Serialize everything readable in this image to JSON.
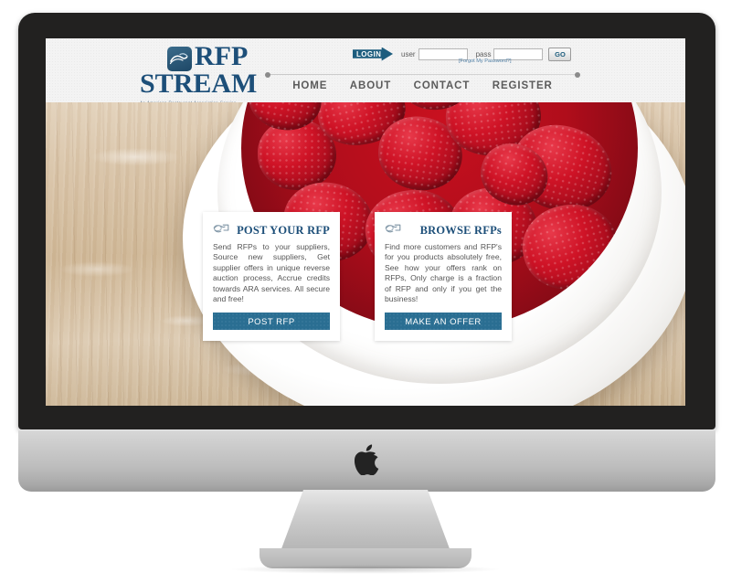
{
  "device": {
    "brand_logo": "apple-logo"
  },
  "site": {
    "logo": {
      "mark": "wave-logo-icon",
      "line1": "RFP",
      "line2": "STREAM",
      "tagline": "An American Restaurant Association Service"
    },
    "login": {
      "button_label": "LOGIN",
      "user_label": "user",
      "user_value": "",
      "user_placeholder": "",
      "pass_label": "pass",
      "pass_value": "",
      "pass_placeholder": "",
      "go_label": "GO",
      "forgot_label": "[Forgot My Password?]"
    },
    "nav": [
      {
        "label": "HOME"
      },
      {
        "label": "ABOUT"
      },
      {
        "label": "CONTACT"
      },
      {
        "label": "REGISTER"
      }
    ],
    "hero": {
      "image_description": "bowl of fresh raspberries in a white cup on a rustic wooden table"
    },
    "cards": [
      {
        "icon": "handshake-icon",
        "title": "POST YOUR RFP",
        "body": "Send RFPs to your suppliers, Source new suppliers, Get supplier offers in unique reverse auction process, Accrue credits towards ARA services. All secure and free!",
        "button_label": "POST RFP"
      },
      {
        "icon": "handshake-icon",
        "title": "BROWSE RFPs",
        "body": "Find more customers and RFP's for you products absolutely free, See how your offers rank on RFPs, Only charge is a fraction of RFP and only if you get the business!",
        "button_label": "MAKE AN OFFER"
      }
    ]
  },
  "colors": {
    "brand_blue": "#1d4f79",
    "button_teal": "#2a6e92",
    "login_arrow": "#1d5d7e",
    "nav_text": "#5b5b5b",
    "berry_red": "#c8101f",
    "bezel": "#222120"
  }
}
